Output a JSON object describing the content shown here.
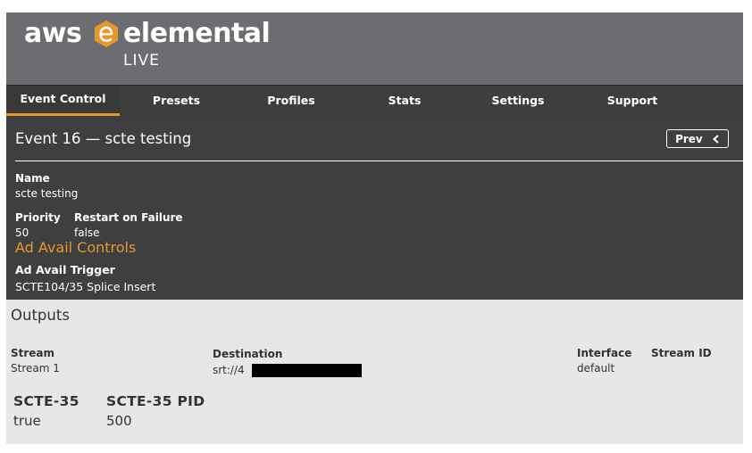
{
  "brand": {
    "aws": "aws",
    "elemental": "elemental",
    "product": "LIVE",
    "accent": "#e8972a"
  },
  "nav": {
    "tabs": [
      {
        "label": "Event Control",
        "active": true
      },
      {
        "label": "Presets"
      },
      {
        "label": "Profiles"
      },
      {
        "label": "Stats"
      },
      {
        "label": "Settings"
      },
      {
        "label": "Support"
      }
    ]
  },
  "event": {
    "title": "Event 16 — scte testing",
    "prev_label": "Prev",
    "name_label": "Name",
    "name_value": "scte testing",
    "priority_label": "Priority",
    "priority_value": "50",
    "restart_label": "Restart on Failure",
    "restart_value": "false",
    "ad_avail_section": "Ad Avail Controls",
    "ad_avail_trigger_label": "Ad Avail Trigger",
    "ad_avail_trigger_value": "SCTE104/35 Splice Insert"
  },
  "outputs": {
    "title": "Outputs",
    "headers": {
      "stream": "Stream",
      "destination": "Destination",
      "interface": "Interface",
      "stream_id": "Stream ID"
    },
    "row": {
      "stream": "Stream 1",
      "destination": "srt://4",
      "interface": "default",
      "stream_id": ""
    },
    "scte35_label": "SCTE-35",
    "scte35_value": "true",
    "scte35_pid_label": "SCTE-35 PID",
    "scte35_pid_value": "500"
  }
}
